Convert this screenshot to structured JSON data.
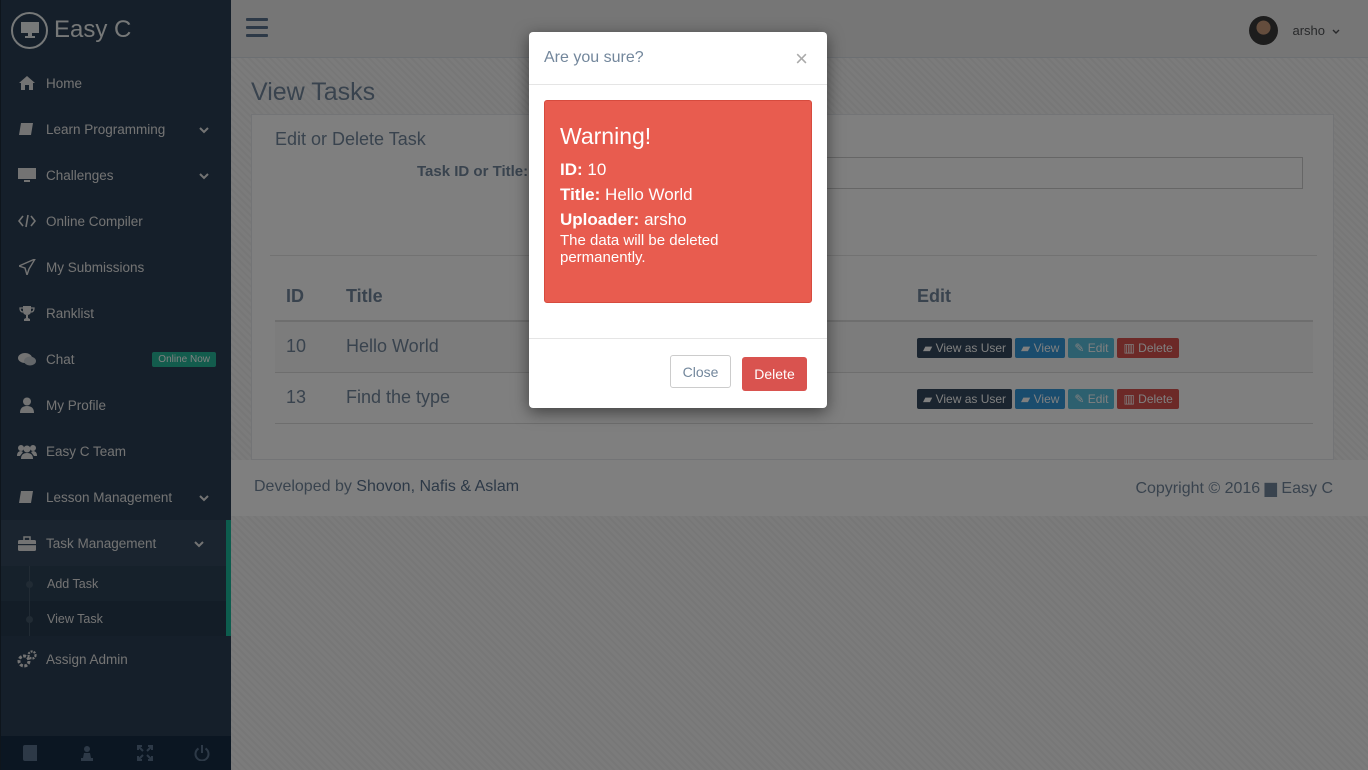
{
  "brand": {
    "name": "Easy C"
  },
  "sidebar": {
    "items": [
      {
        "label": "Home",
        "icon": "home-icon"
      },
      {
        "label": "Learn Programming",
        "icon": "book-icon",
        "expandable": true
      },
      {
        "label": "Challenges",
        "icon": "desktop-icon",
        "expandable": true
      },
      {
        "label": "Online Compiler",
        "icon": "code-icon"
      },
      {
        "label": "My Submissions",
        "icon": "paper-plane-icon"
      },
      {
        "label": "Ranklist",
        "icon": "trophy-icon"
      },
      {
        "label": "Chat",
        "icon": "comments-icon",
        "badge": "Online Now"
      },
      {
        "label": "My Profile",
        "icon": "user-icon"
      },
      {
        "label": "Easy C Team",
        "icon": "users-icon"
      },
      {
        "label": "Lesson Management",
        "icon": "book-icon",
        "expandable": true
      },
      {
        "label": "Task Management",
        "icon": "briefcase-icon",
        "expandable": true,
        "active": true
      },
      {
        "label": "Assign Admin",
        "icon": "cogs-icon"
      }
    ],
    "sub_items": [
      {
        "label": "Add Task"
      },
      {
        "label": "View Task"
      }
    ]
  },
  "topbar": {
    "username": "arsho"
  },
  "page": {
    "title": "View Tasks",
    "panel_title": "Edit or Delete Task",
    "search_label": "Task ID or Title:",
    "table": {
      "headers": [
        "ID",
        "Title",
        "",
        "",
        "Edit"
      ],
      "rows": [
        {
          "id": "10",
          "title": "Hello World"
        },
        {
          "id": "13",
          "title": "Find the type"
        }
      ],
      "buttons": {
        "view_as_user": "View as User",
        "view": "View",
        "edit": "Edit",
        "delete": "Delete"
      }
    }
  },
  "footer": {
    "left_prefix": "Developed by",
    "left_names": "Shovon, Nafis & Aslam",
    "right_prefix": "Copyright © 2016",
    "right_brand": "Easy C"
  },
  "modal": {
    "title": "Are you sure?",
    "close_symbol": "×",
    "warning_heading": "Warning!",
    "id_label": "ID:",
    "id_value": "10",
    "title_label": "Title:",
    "title_value": "Hello World",
    "uploader_label": "Uploader:",
    "uploader_value": "arsho",
    "note": "The data will be deleted permanently.",
    "close_button": "Close",
    "delete_button": "Delete"
  },
  "colors": {
    "sidebar_bg": "#2a3f54",
    "accent": "#1abb9c",
    "danger": "#d9534f",
    "alert_bg": "#e85c4f",
    "text_muted": "#73879c"
  }
}
